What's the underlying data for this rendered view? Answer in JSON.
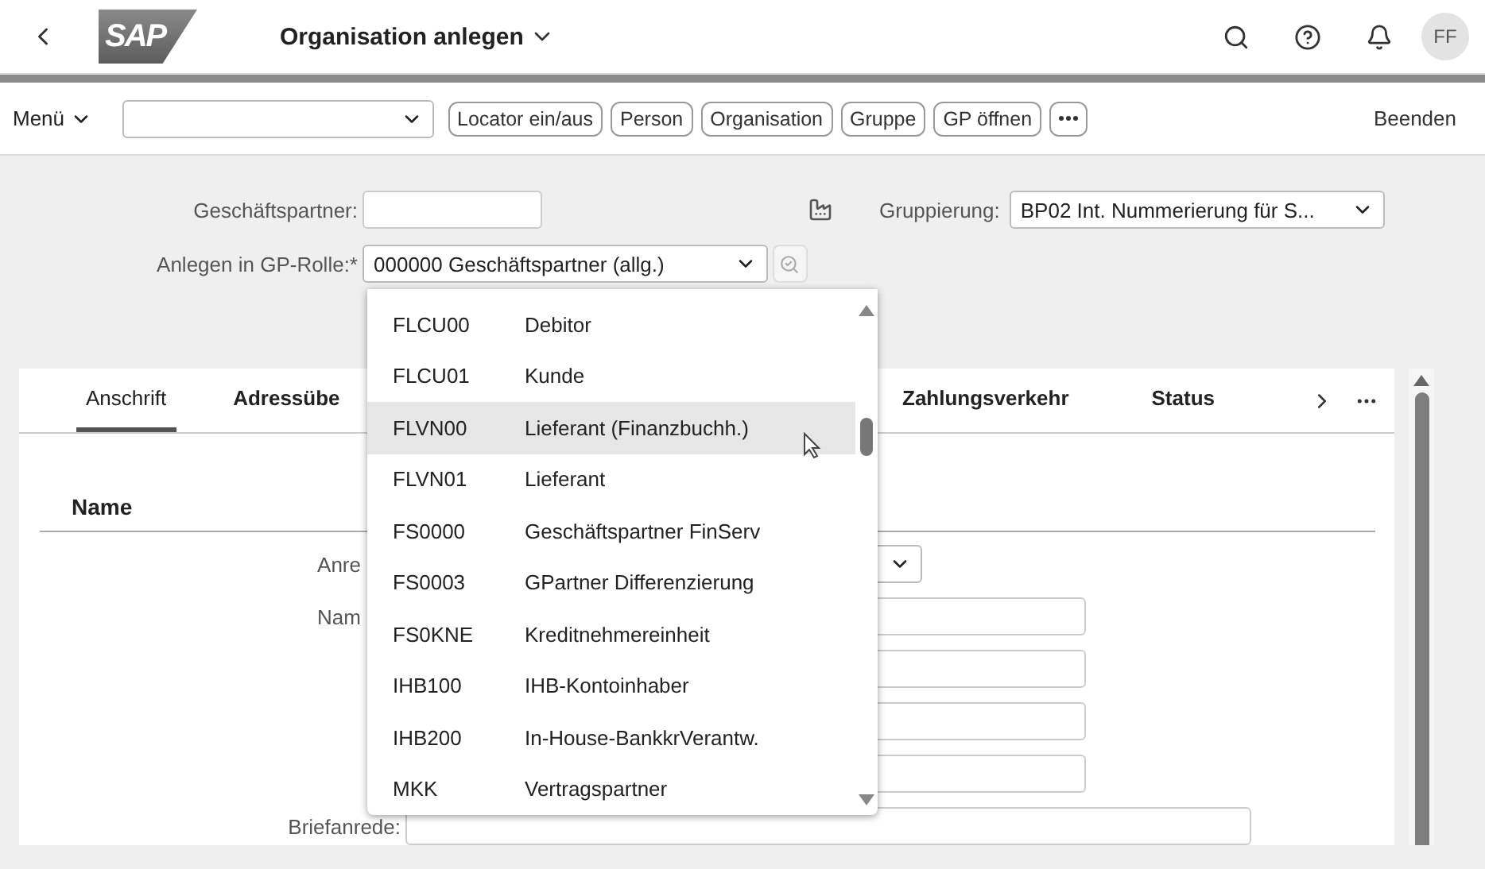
{
  "header": {
    "logo": "SAP",
    "title": "Organisation anlegen",
    "avatar": "FF"
  },
  "toolbar": {
    "menu": "Menü",
    "buttons": [
      "Locator ein/aus",
      "Person",
      "Organisation",
      "Gruppe",
      "GP öffnen"
    ],
    "exit": "Beenden"
  },
  "form": {
    "partner_label": "Geschäftspartner:",
    "grouping_label": "Gruppierung:",
    "grouping_value": "BP02 Int. Nummerierung für S...",
    "role_label": "Anlegen in GP-Rolle:*",
    "role_value": "000000 Geschäftspartner (allg.)"
  },
  "role_options": [
    {
      "code": "FLCU00",
      "text": "Debitor",
      "selected": false
    },
    {
      "code": "FLCU01",
      "text": "Kunde",
      "selected": false
    },
    {
      "code": "FLVN00",
      "text": "Lieferant (Finanzbuchh.)",
      "selected": true
    },
    {
      "code": "FLVN01",
      "text": "Lieferant",
      "selected": false
    },
    {
      "code": "FS0000",
      "text": "Geschäftspartner FinServ",
      "selected": false
    },
    {
      "code": "FS0003",
      "text": "GPartner Differenzierung",
      "selected": false
    },
    {
      "code": "FS0KNE",
      "text": "Kreditnehmereinheit",
      "selected": false
    },
    {
      "code": "IHB100",
      "text": "IHB-Kontoinhaber",
      "selected": false
    },
    {
      "code": "IHB200",
      "text": "In-House-BankkrVerantw.",
      "selected": false
    },
    {
      "code": "MKK",
      "text": "Vertragspartner",
      "selected": false
    }
  ],
  "tabs": [
    {
      "label": "Anschrift",
      "selected": true
    },
    {
      "label": "Adressübe",
      "selected": false
    },
    {
      "label": "Zahlungsverkehr",
      "selected": false
    },
    {
      "label": "Status",
      "selected": false
    }
  ],
  "section": {
    "title": "Name",
    "rows": [
      {
        "kind": "select",
        "label": "Anre"
      },
      {
        "kind": "input",
        "label": "Nam"
      },
      {
        "kind": "input"
      },
      {
        "kind": "input"
      },
      {
        "kind": "input"
      },
      {
        "kind": "wide",
        "label": "Briefanrede:"
      }
    ]
  }
}
